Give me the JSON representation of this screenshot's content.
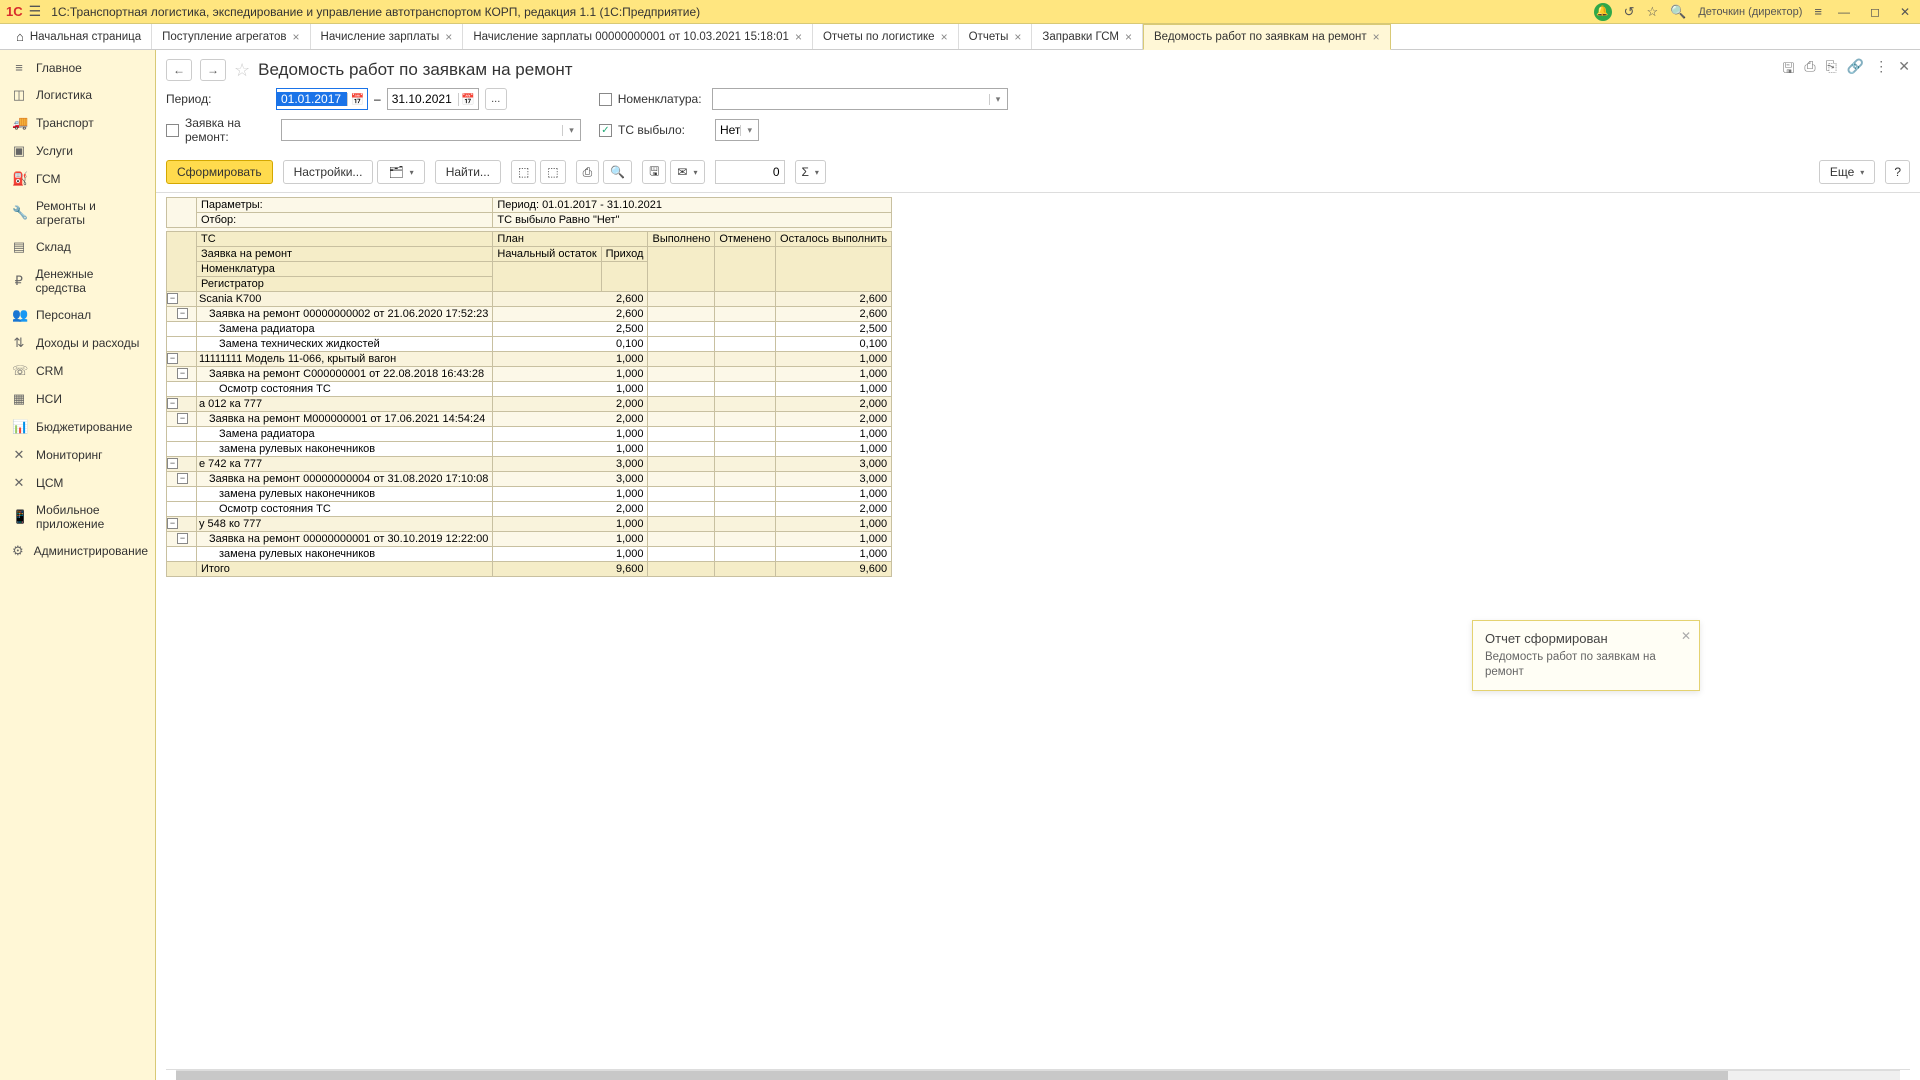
{
  "app": {
    "logo": "1C",
    "title": "1С:Транспортная логистика, экспедирование и управление автотранспортом КОРП, редакция 1.1  (1С:Предприятие)",
    "user": "Деточкин (директор)"
  },
  "tabs": {
    "home": "Начальная страница",
    "items": [
      {
        "label": "Поступление агрегатов"
      },
      {
        "label": "Начисление зарплаты"
      },
      {
        "label": "Начисление зарплаты 00000000001 от 10.03.2021 15:18:01"
      },
      {
        "label": "Отчеты по логистике"
      },
      {
        "label": "Отчеты"
      },
      {
        "label": "Заправки ГСМ"
      },
      {
        "label": "Ведомость работ по заявкам на ремонт",
        "active": true
      }
    ]
  },
  "sidebar": [
    {
      "icon": "≡",
      "label": "Главное"
    },
    {
      "icon": "◫",
      "label": "Логистика"
    },
    {
      "icon": "🚚",
      "label": "Транспорт"
    },
    {
      "icon": "▣",
      "label": "Услуги"
    },
    {
      "icon": "⛽",
      "label": "ГСМ"
    },
    {
      "icon": "🔧",
      "label": "Ремонты и агрегаты"
    },
    {
      "icon": "▤",
      "label": "Склад"
    },
    {
      "icon": "₽",
      "label": "Денежные средства"
    },
    {
      "icon": "👥",
      "label": "Персонал"
    },
    {
      "icon": "⇅",
      "label": "Доходы и расходы"
    },
    {
      "icon": "☏",
      "label": "CRM"
    },
    {
      "icon": "▦",
      "label": "НСИ"
    },
    {
      "icon": "📊",
      "label": "Бюджетирование"
    },
    {
      "icon": "✕",
      "label": "Мониторинг"
    },
    {
      "icon": "✕",
      "label": "ЦСМ"
    },
    {
      "icon": "📱",
      "label": "Мобильное приложение"
    },
    {
      "icon": "⚙",
      "label": "Администрирование"
    }
  ],
  "page": {
    "title": "Ведомость работ по заявкам на ремонт"
  },
  "filters": {
    "period_label": "Период:",
    "period_from": "01.01.2017",
    "period_sep": "–",
    "period_to": "31.10.2021",
    "ellipsis": "...",
    "zayavka_label": "Заявка на ремонт:",
    "nomen_label": "Номенклатура:",
    "ts_vybylo_label": "ТС выбыло:",
    "ts_vybylo_value": "Нет"
  },
  "toolbar": {
    "run": "Сформировать",
    "settings": "Настройки...",
    "find": "Найти...",
    "num": "0",
    "more": "Еще",
    "help": "?"
  },
  "report": {
    "meta": {
      "params_label": "Параметры:",
      "params_value": "Период: 01.01.2017 - 31.10.2021",
      "filter_label": "Отбор:",
      "filter_value": "ТС выбыло Равно \"Нет\""
    },
    "headers": {
      "r1c1": "ТС",
      "r1c2": "План",
      "r1c3": "Выполнено",
      "r1c4": "Отменено",
      "r1c5": "Осталось выполнить",
      "r2c1": "Заявка на ремонт",
      "r2c2": "Начальный остаток",
      "r2c3": "Приход",
      "r3c1": "Номенклатура",
      "r4c1": "Регистратор"
    },
    "rows": [
      {
        "lvl": 0,
        "label": "Scania K700",
        "plan": "2,600",
        "ost": "2,600"
      },
      {
        "lvl": 1,
        "label": "Заявка на ремонт 00000000002 от 21.06.2020 17:52:23",
        "plan": "2,600",
        "ost": "2,600"
      },
      {
        "lvl": 2,
        "label": "Замена радиатора",
        "plan": "2,500",
        "ost": "2,500"
      },
      {
        "lvl": 2,
        "label": "Замена технических жидкостей",
        "plan": "0,100",
        "ost": "0,100"
      },
      {
        "lvl": 0,
        "label": "11111111 Модель 11-066, крытый вагон",
        "plan": "1,000",
        "ost": "1,000"
      },
      {
        "lvl": 1,
        "label": "Заявка на ремонт C000000001 от 22.08.2018 16:43:28",
        "plan": "1,000",
        "ost": "1,000"
      },
      {
        "lvl": 2,
        "label": "Осмотр состояния ТС",
        "plan": "1,000",
        "ost": "1,000"
      },
      {
        "lvl": 0,
        "label": "а 012 ка 777",
        "plan": "2,000",
        "ost": "2,000"
      },
      {
        "lvl": 1,
        "label": "Заявка на ремонт M000000001 от 17.06.2021 14:54:24",
        "plan": "2,000",
        "ost": "2,000"
      },
      {
        "lvl": 2,
        "label": "Замена радиатора",
        "plan": "1,000",
        "ost": "1,000"
      },
      {
        "lvl": 2,
        "label": "замена рулевых наконечников",
        "plan": "1,000",
        "ost": "1,000"
      },
      {
        "lvl": 0,
        "label": "е 742 ка 777",
        "plan": "3,000",
        "ost": "3,000"
      },
      {
        "lvl": 1,
        "label": "Заявка на ремонт 00000000004 от 31.08.2020 17:10:08",
        "plan": "3,000",
        "ost": "3,000"
      },
      {
        "lvl": 2,
        "label": "замена рулевых наконечников",
        "plan": "1,000",
        "ost": "1,000"
      },
      {
        "lvl": 2,
        "label": "Осмотр состояния ТС",
        "plan": "2,000",
        "ost": "2,000"
      },
      {
        "lvl": 0,
        "label": "у 548 ко 777",
        "plan": "1,000",
        "ost": "1,000"
      },
      {
        "lvl": 1,
        "label": "Заявка на ремонт 00000000001 от 30.10.2019 12:22:00",
        "plan": "1,000",
        "ost": "1,000"
      },
      {
        "lvl": 2,
        "label": "замена рулевых наконечников",
        "plan": "1,000",
        "ost": "1,000"
      }
    ],
    "total": {
      "label": "Итого",
      "plan": "9,600",
      "ost": "9,600"
    }
  },
  "toast": {
    "title": "Отчет сформирован",
    "body": "Ведомость работ по заявкам на ремонт"
  }
}
